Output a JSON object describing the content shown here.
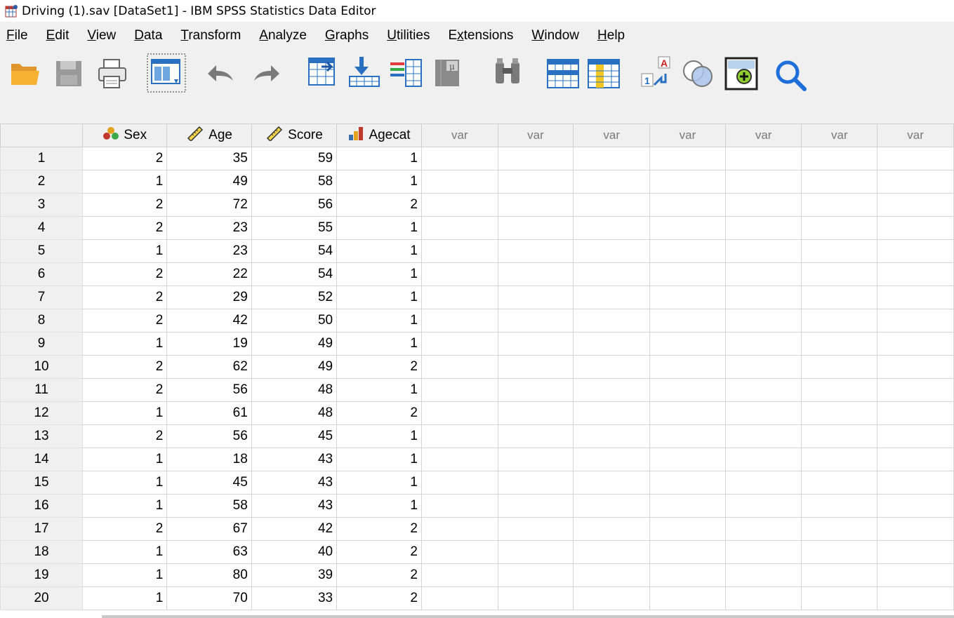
{
  "window": {
    "title": "Driving (1).sav [DataSet1] - IBM SPSS Statistics Data Editor"
  },
  "menu": [
    {
      "mn": "F",
      "rest": "ile"
    },
    {
      "mn": "E",
      "rest": "dit"
    },
    {
      "mn": "V",
      "rest": "iew"
    },
    {
      "mn": "D",
      "rest": "ata"
    },
    {
      "mn": "T",
      "rest": "ransform"
    },
    {
      "mn": "A",
      "rest": "nalyze"
    },
    {
      "mn": "G",
      "rest": "raphs"
    },
    {
      "mn": "U",
      "rest": "tilities"
    },
    {
      "pre": "E",
      "mn": "x",
      "rest": "tensions"
    },
    {
      "mn": "W",
      "rest": "indow"
    },
    {
      "mn": "H",
      "rest": "elp"
    }
  ],
  "toolbar_icons": [
    "open-folder-icon",
    "save-icon",
    "print-icon",
    "recall-dialog-icon",
    "undo-icon",
    "redo-icon",
    "go-to-case-icon",
    "go-to-variable-icon",
    "variables-icon",
    "descriptive-stats-icon",
    "find-icon",
    "insert-cases-icon",
    "insert-variable-icon",
    "split-file-icon",
    "select-cases-icon",
    "value-labels-icon",
    "search-icon"
  ],
  "columns": [
    {
      "name": "Sex",
      "icon": "nominal-icon"
    },
    {
      "name": "Age",
      "icon": "scale-icon"
    },
    {
      "name": "Score",
      "icon": "scale-icon"
    },
    {
      "name": "Agecat",
      "icon": "ordinal-icon"
    }
  ],
  "empty_col_label": "var",
  "empty_col_count": 7,
  "rows": [
    [
      "2",
      "35",
      "59",
      "1"
    ],
    [
      "1",
      "49",
      "58",
      "1"
    ],
    [
      "2",
      "72",
      "56",
      "2"
    ],
    [
      "2",
      "23",
      "55",
      "1"
    ],
    [
      "1",
      "23",
      "54",
      "1"
    ],
    [
      "2",
      "22",
      "54",
      "1"
    ],
    [
      "2",
      "29",
      "52",
      "1"
    ],
    [
      "2",
      "42",
      "50",
      "1"
    ],
    [
      "1",
      "19",
      "49",
      "1"
    ],
    [
      "2",
      "62",
      "49",
      "2"
    ],
    [
      "2",
      "56",
      "48",
      "1"
    ],
    [
      "1",
      "61",
      "48",
      "2"
    ],
    [
      "2",
      "56",
      "45",
      "1"
    ],
    [
      "1",
      "18",
      "43",
      "1"
    ],
    [
      "1",
      "45",
      "43",
      "1"
    ],
    [
      "1",
      "58",
      "43",
      "1"
    ],
    [
      "2",
      "67",
      "42",
      "2"
    ],
    [
      "1",
      "63",
      "40",
      "2"
    ],
    [
      "1",
      "80",
      "39",
      "2"
    ],
    [
      "1",
      "70",
      "33",
      "2"
    ]
  ]
}
